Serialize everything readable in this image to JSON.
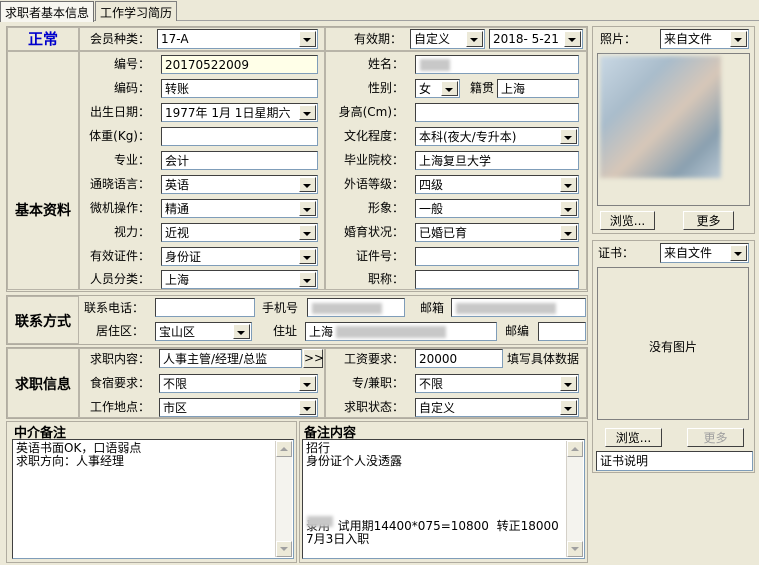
{
  "tabs": [
    "求职者基本信息",
    "工作学习简历"
  ],
  "status": "正常",
  "sections": {
    "basic": "基本资料",
    "contact": "联系方式",
    "job": "求职信息"
  },
  "member": {
    "label": "会员种类：",
    "value": "17-A"
  },
  "validity": {
    "label": "有效期：",
    "mode": "自定义",
    "date": "2018- 5-21"
  },
  "basic": {
    "number": {
      "label": "编号：",
      "value": "20170522009"
    },
    "code": {
      "label": "编码：",
      "value": "转账"
    },
    "birth": {
      "label": "出生日期：",
      "value": "1977年 1月 1日星期六"
    },
    "weight": {
      "label": "体重(Kg)：",
      "value": ""
    },
    "major": {
      "label": "专业：",
      "value": "会计"
    },
    "language": {
      "label": "通晓语言：",
      "value": "英语"
    },
    "computer": {
      "label": "微机操作：",
      "value": "精通"
    },
    "vision": {
      "label": "视力：",
      "value": "近视"
    },
    "id_type": {
      "label": "有效证件：",
      "value": "身份证"
    },
    "category": {
      "label": "人员分类：",
      "value": "上海"
    },
    "name": {
      "label": "姓名：",
      "value": ""
    },
    "gender": {
      "label": "性别：",
      "value": "女"
    },
    "origin": {
      "label": "籍贯",
      "value": "上海"
    },
    "height": {
      "label": "身高(Cm)：",
      "value": ""
    },
    "education": {
      "label": "文化程度：",
      "value": "本科(夜大/专升本)"
    },
    "school": {
      "label": "毕业院校：",
      "value": "上海复旦大学"
    },
    "lang_level": {
      "label": "外语等级：",
      "value": "四级"
    },
    "appearance": {
      "label": "形象：",
      "value": "一般"
    },
    "marital": {
      "label": "婚育状况：",
      "value": "已婚已育"
    },
    "id_number": {
      "label": "证件号：",
      "value": ""
    },
    "title": {
      "label": "职称：",
      "value": ""
    }
  },
  "contact": {
    "phone": {
      "label": "联系电话：",
      "value": ""
    },
    "mobile": {
      "label": "手机号",
      "value": ""
    },
    "email": {
      "label": "邮箱",
      "value": ""
    },
    "district": {
      "label": "居住区：",
      "value": "宝山区"
    },
    "address": {
      "label": "住址",
      "value": "上海"
    },
    "zip": {
      "label": "邮编",
      "value": ""
    }
  },
  "job": {
    "content": {
      "label": "求职内容：",
      "value": "人事主管/经理/总监",
      "more": ">>"
    },
    "salary": {
      "label": "工资要求：",
      "value": "20000",
      "hint": "填写具体数据"
    },
    "board": {
      "label": "食宿要求：",
      "value": "不限"
    },
    "parttime": {
      "label": "专/兼职：",
      "value": "不限"
    },
    "location": {
      "label": "工作地点：",
      "value": "市区"
    },
    "state": {
      "label": "求职状态：",
      "value": "自定义"
    }
  },
  "notes": {
    "agent_title": "中介备注",
    "agent_text": "英语书面OK，口语弱点\n求职方向：人事经理",
    "remark_title": "备注内容",
    "remark_text": "招行\n身份证个人没透露\n\n\n\n\n录用  试用期14400*075=10800  转正18000\n7月3日入职"
  },
  "photo": {
    "label": "照片：",
    "source": "来自文件",
    "browse": "浏览...",
    "more": "更多"
  },
  "cert": {
    "label": "证书：",
    "source": "来自文件",
    "empty": "没有图片",
    "browse": "浏览...",
    "more": "更多",
    "desc": "证书说明"
  }
}
